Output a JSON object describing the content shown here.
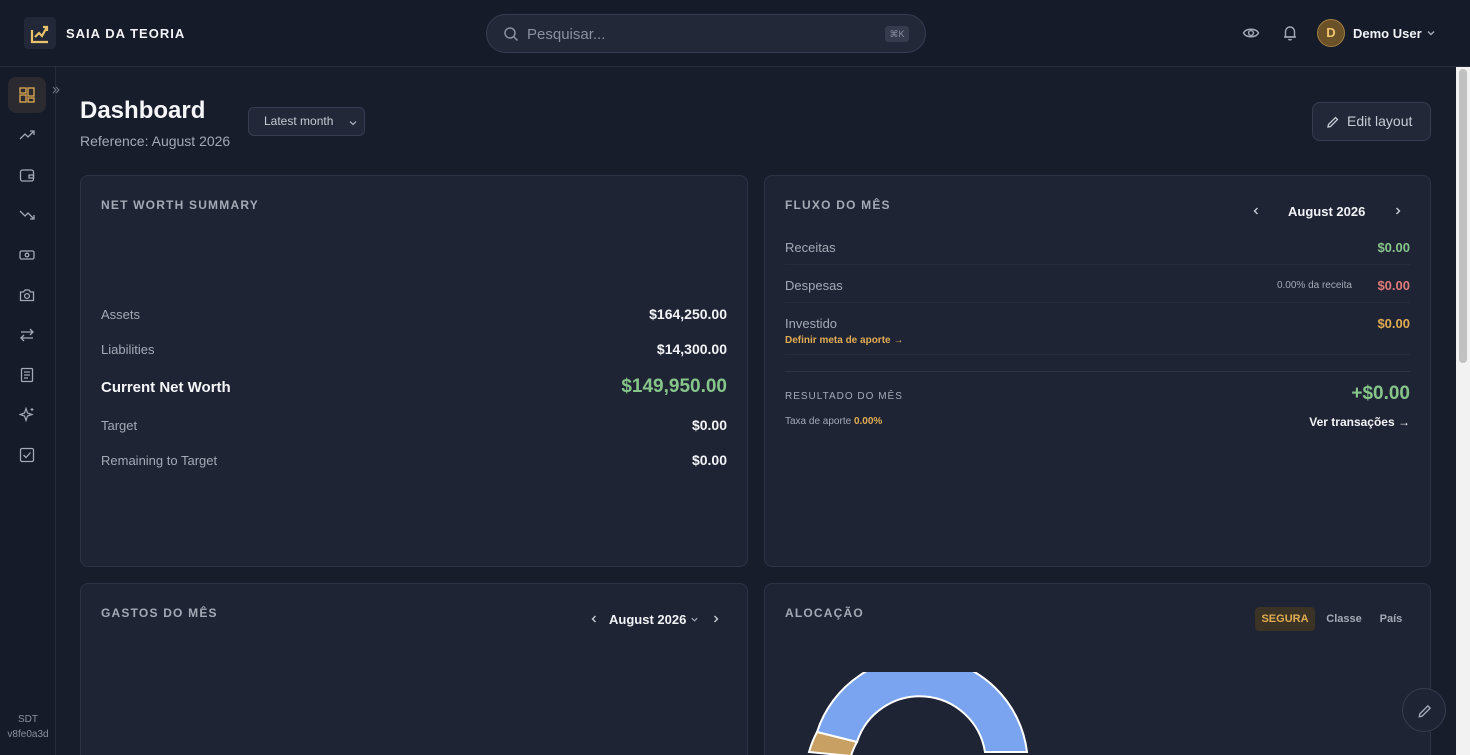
{
  "app": {
    "brand": "SAIA DA TEORIA",
    "search_placeholder": "Pesquisar...",
    "search_shortcut": "⌘K",
    "user_initial": "D",
    "user_name": "Demo User",
    "version_label": "SDT",
    "version_hash": "v8fe0a3d"
  },
  "sidebar": {
    "items": [
      {
        "icon": "dashboard-icon",
        "active": true
      },
      {
        "icon": "trending-up-icon"
      },
      {
        "icon": "wallet-icon"
      },
      {
        "icon": "trending-down-icon"
      },
      {
        "icon": "banknote-icon"
      },
      {
        "icon": "camera-icon"
      },
      {
        "icon": "transfer-icon"
      },
      {
        "icon": "report-icon"
      },
      {
        "icon": "sparkles-icon"
      },
      {
        "icon": "checkbox-icon"
      }
    ]
  },
  "header": {
    "title": "Dashboard",
    "reference": "Reference: August 2026",
    "period": "Latest month",
    "edit_label": "Edit layout"
  },
  "net_worth": {
    "title": "NET WORTH SUMMARY",
    "assets_label": "Assets",
    "assets_value": "$164,250.00",
    "liabilities_label": "Liabilities",
    "liabilities_value": "$14,300.00",
    "net_worth_label": "Current Net Worth",
    "net_worth_value": "$149,950.00",
    "target_label": "Target",
    "target_value": "$0.00",
    "remaining_label": "Remaining to Target",
    "remaining_value": "$0.00"
  },
  "fluxo": {
    "title": "FLUXO DO MÊS",
    "month": "August 2026",
    "receitas_label": "Receitas",
    "receitas_value": "$0.00",
    "despesas_label": "Despesas",
    "despesas_pct": "0.00% da receita",
    "despesas_value": "$0.00",
    "investido_label": "Investido",
    "investido_value": "$0.00",
    "meta_link": "Definir meta de aporte →",
    "resultado_label": "RESULTADO DO MÊS",
    "resultado_value": "+$0.00",
    "taxa_label": "Taxa de aporte",
    "taxa_value": "0.00%",
    "ver_link": "Ver transações →"
  },
  "gastos": {
    "title": "GASTOS DO MÊS",
    "month": "August 2026"
  },
  "alocacao": {
    "title": "ALOCAÇÃO",
    "tabs": [
      "SEGURA",
      "Classe",
      "País"
    ],
    "active_tab": 0,
    "colors": {
      "blue": "#7aa4ef",
      "gold": "#c9a063"
    }
  }
}
